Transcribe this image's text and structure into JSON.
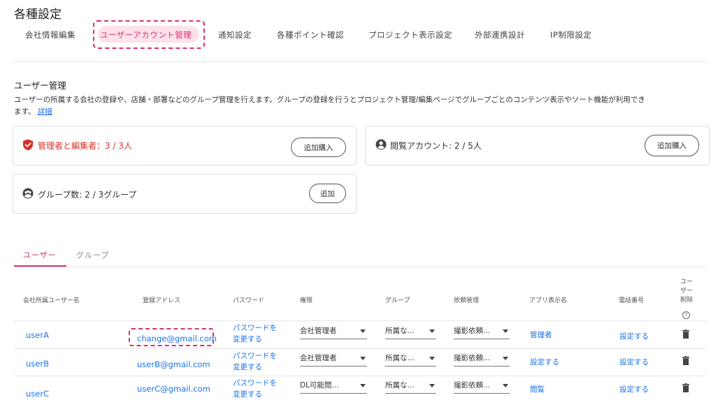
{
  "page_title": "各種設定",
  "tabs": [
    {
      "label": "会社情報編集"
    },
    {
      "label": "ユーザーアカウント管理"
    },
    {
      "label": "通知設定"
    },
    {
      "label": "各種ポイント確認"
    },
    {
      "label": "プロジェクト表示設定"
    },
    {
      "label": "外部連携設計"
    },
    {
      "label": "IP制限設定"
    }
  ],
  "section": {
    "title": "ユーザー管理",
    "description": "ユーザーの所属する会社の登録や、店舗・部署などのグループ管理を行えます。グループの登録を行うとプロジェクト管理/編集ページでグループごとのコンテンツ表示やソート機能が利用でき",
    "description_cont": "ます。",
    "detail_link": "詳細"
  },
  "cards": {
    "admins": {
      "label": "管理者と編集者：3 / 3人",
      "button": "追加購入"
    },
    "viewers": {
      "label": "閲覧アカウント: 2 / 5人",
      "button": "追加購入"
    },
    "groups": {
      "label": "グループ数: 2 / 3グループ",
      "button": "追加"
    }
  },
  "subtabs": {
    "users": "ユーザー",
    "groups": "グループ"
  },
  "table": {
    "headers": {
      "name": "会社所属ユーザー名",
      "email": "登録アドレス",
      "password": "パスワード",
      "role": "権限",
      "group": "グループ",
      "request": "依頼管理",
      "app_name": "アプリ表示名",
      "phone": "電話番号",
      "delete_1": "ユー",
      "delete_2": "ザー",
      "delete_3": "削除",
      "delete_help": "?"
    },
    "rows": [
      {
        "name": "userA",
        "email": "change@gmail.com",
        "pw1": "パスワードを",
        "pw2": "変更する",
        "role": "会社管理者",
        "group": "所属な...",
        "request": "撮影依頼...",
        "app_name": "管理者",
        "phone": "設定する"
      },
      {
        "name": "userB",
        "email": "userB@gmail.com",
        "pw1": "パスワードを",
        "pw2": "変更する",
        "role": "会社管理者",
        "group": "所属な...",
        "request": "撮影依頼...",
        "app_name": "設定する",
        "phone": "設定する"
      },
      {
        "name": "userC",
        "email": "userC@gmail.com",
        "pw1": "パスワードを",
        "pw2": "変更する",
        "role": "DL可能閲...",
        "group": "所属な...",
        "request": "撮影依頼...",
        "app_name": "閲覧",
        "phone": "設定する"
      }
    ]
  },
  "colors": {
    "accent": "#d6336c",
    "accent_bg": "#fde2ea",
    "link": "#1a73e8",
    "admin_label": "#d93025"
  }
}
